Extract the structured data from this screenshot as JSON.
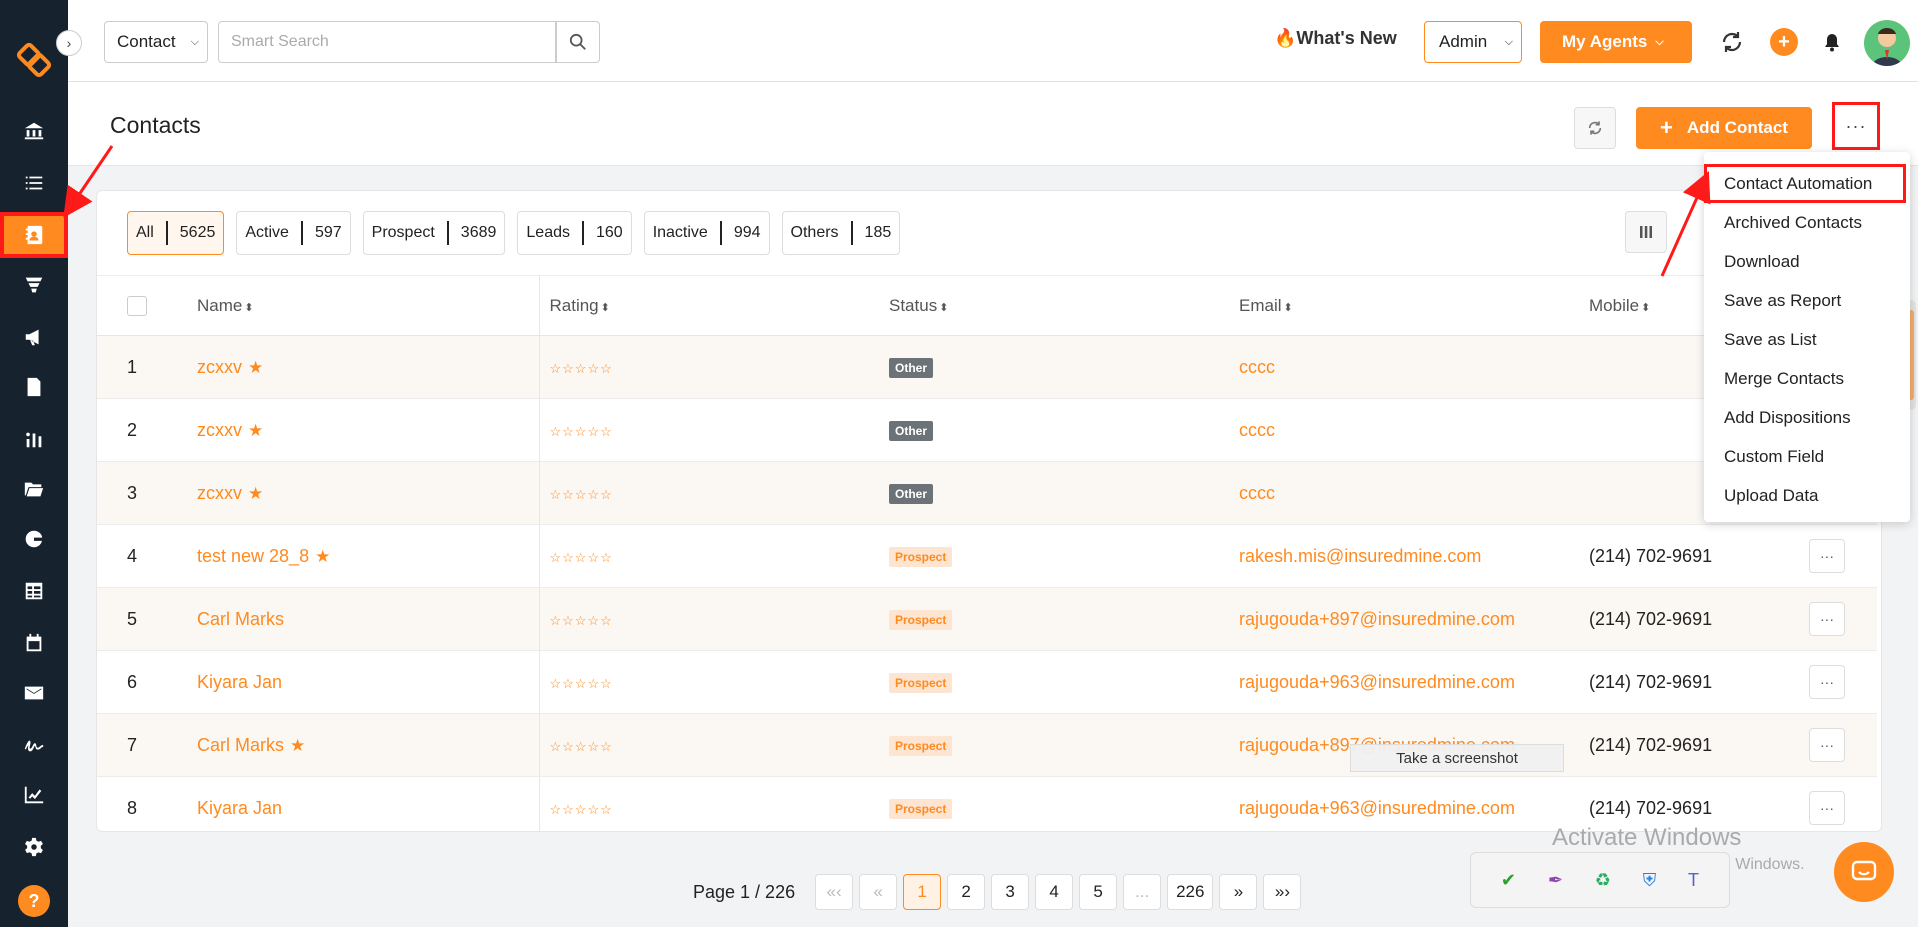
{
  "sidebar": {
    "items": [
      {
        "icon": "bank-icon"
      },
      {
        "icon": "list-icon"
      },
      {
        "icon": "contact-book-icon",
        "active": true
      },
      {
        "icon": "funnel-icon"
      },
      {
        "icon": "megaphone-icon"
      },
      {
        "icon": "document-icon"
      },
      {
        "icon": "users-chart-icon"
      },
      {
        "icon": "folder-open-icon"
      },
      {
        "icon": "google-icon"
      },
      {
        "icon": "table-icon"
      },
      {
        "icon": "calendar-icon"
      },
      {
        "icon": "mail-icon"
      },
      {
        "icon": "signature-icon"
      },
      {
        "icon": "line-chart-icon"
      },
      {
        "icon": "gear-icon"
      }
    ],
    "help_label": "?"
  },
  "topbar": {
    "context_select": "Contact",
    "search_placeholder": "Smart Search",
    "whats_new": "What's New",
    "role_select": "Admin",
    "agents_button": "My Agents",
    "plus_label": "+"
  },
  "page": {
    "title": "Contacts",
    "add_button": "Add Contact",
    "more_button": "···"
  },
  "filters": [
    {
      "label": "All",
      "count": "5625",
      "active": true
    },
    {
      "label": "Active",
      "count": "597"
    },
    {
      "label": "Prospect",
      "count": "3689"
    },
    {
      "label": "Leads",
      "count": "160"
    },
    {
      "label": "Inactive",
      "count": "994"
    },
    {
      "label": "Others",
      "count": "185"
    }
  ],
  "table": {
    "headers": {
      "name": "Name",
      "rating": "Rating",
      "status": "Status",
      "email": "Email",
      "mobile": "Mobile"
    },
    "rows": [
      {
        "num": "1",
        "name": "zcxxv",
        "starred": true,
        "rating": "☆☆☆☆☆",
        "status": "Other",
        "email": "cccc",
        "mobile": ""
      },
      {
        "num": "2",
        "name": "zcxxv",
        "starred": true,
        "rating": "☆☆☆☆☆",
        "status": "Other",
        "email": "cccc",
        "mobile": ""
      },
      {
        "num": "3",
        "name": "zcxxv",
        "starred": true,
        "rating": "☆☆☆☆☆",
        "status": "Other",
        "email": "cccc",
        "mobile": ""
      },
      {
        "num": "4",
        "name": "test new 28_8",
        "starred": true,
        "rating": "☆☆☆☆☆",
        "status": "Prospect",
        "email": "rakesh.mis@insuredmine.com",
        "mobile": "(214) 702-9691"
      },
      {
        "num": "5",
        "name": "Carl Marks",
        "starred": false,
        "rating": "☆☆☆☆☆",
        "status": "Prospect",
        "email": "rajugouda+897@insuredmine.com",
        "mobile": "(214) 702-9691"
      },
      {
        "num": "6",
        "name": "Kiyara Jan",
        "starred": false,
        "rating": "☆☆☆☆☆",
        "status": "Prospect",
        "email": "rajugouda+963@insuredmine.com",
        "mobile": "(214) 702-9691"
      },
      {
        "num": "7",
        "name": "Carl Marks",
        "starred": true,
        "rating": "☆☆☆☆☆",
        "status": "Prospect",
        "email": "rajugouda+897@insuredmine.com",
        "mobile": "(214) 702-9691"
      },
      {
        "num": "8",
        "name": "Kiyara Jan",
        "starred": false,
        "rating": "☆☆☆☆☆",
        "status": "Prospect",
        "email": "rajugouda+963@insuredmine.com",
        "mobile": "(214) 702-9691"
      }
    ]
  },
  "dropdown": [
    "Contact Automation",
    "Archived Contacts",
    "Download",
    "Save as Report",
    "Save as List",
    "Merge Contacts",
    "Add Dispositions",
    "Custom Field",
    "Upload Data"
  ],
  "pagination": {
    "info": "Page 1 / 226",
    "pages": [
      "«‹",
      "«",
      "1",
      "2",
      "3",
      "4",
      "5",
      "...",
      "226",
      "»",
      "»›"
    ],
    "current": "1"
  },
  "overlay": {
    "tooltip": "Take a screenshot",
    "activate_title": "Activate Windows",
    "activate_sub": "Go to Settings to activate Windows."
  },
  "colors": {
    "accent": "#ff8a1f",
    "sidebar": "#16232f",
    "annotation": "#ff1a1a"
  }
}
